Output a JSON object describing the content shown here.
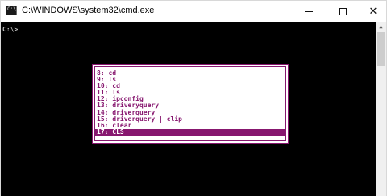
{
  "window": {
    "title": "C:\\WINDOWS\\system32\\cmd.exe",
    "icon": "cmd-app-icon",
    "icon_glyph": "C:\\"
  },
  "controls": {
    "minimize": "minimize-icon",
    "maximize": "maximize-icon",
    "close": "close-icon",
    "close_glyph": "✕"
  },
  "console": {
    "prompt": "C:\\>"
  },
  "scrollbar": {
    "up_arrow": "▲"
  },
  "history": {
    "items": [
      "8: cd",
      "9: ls",
      "10: cd",
      "11: ls",
      "12: ipconfig",
      "13: driveryquery",
      "14: driverquery",
      "15: driverquery | clip",
      "16: clear",
      "17: CLS"
    ],
    "selected_index": 9
  },
  "colors": {
    "console_bg": "#000000",
    "history_accent": "#87176f",
    "history_bg": "#ffffff"
  }
}
